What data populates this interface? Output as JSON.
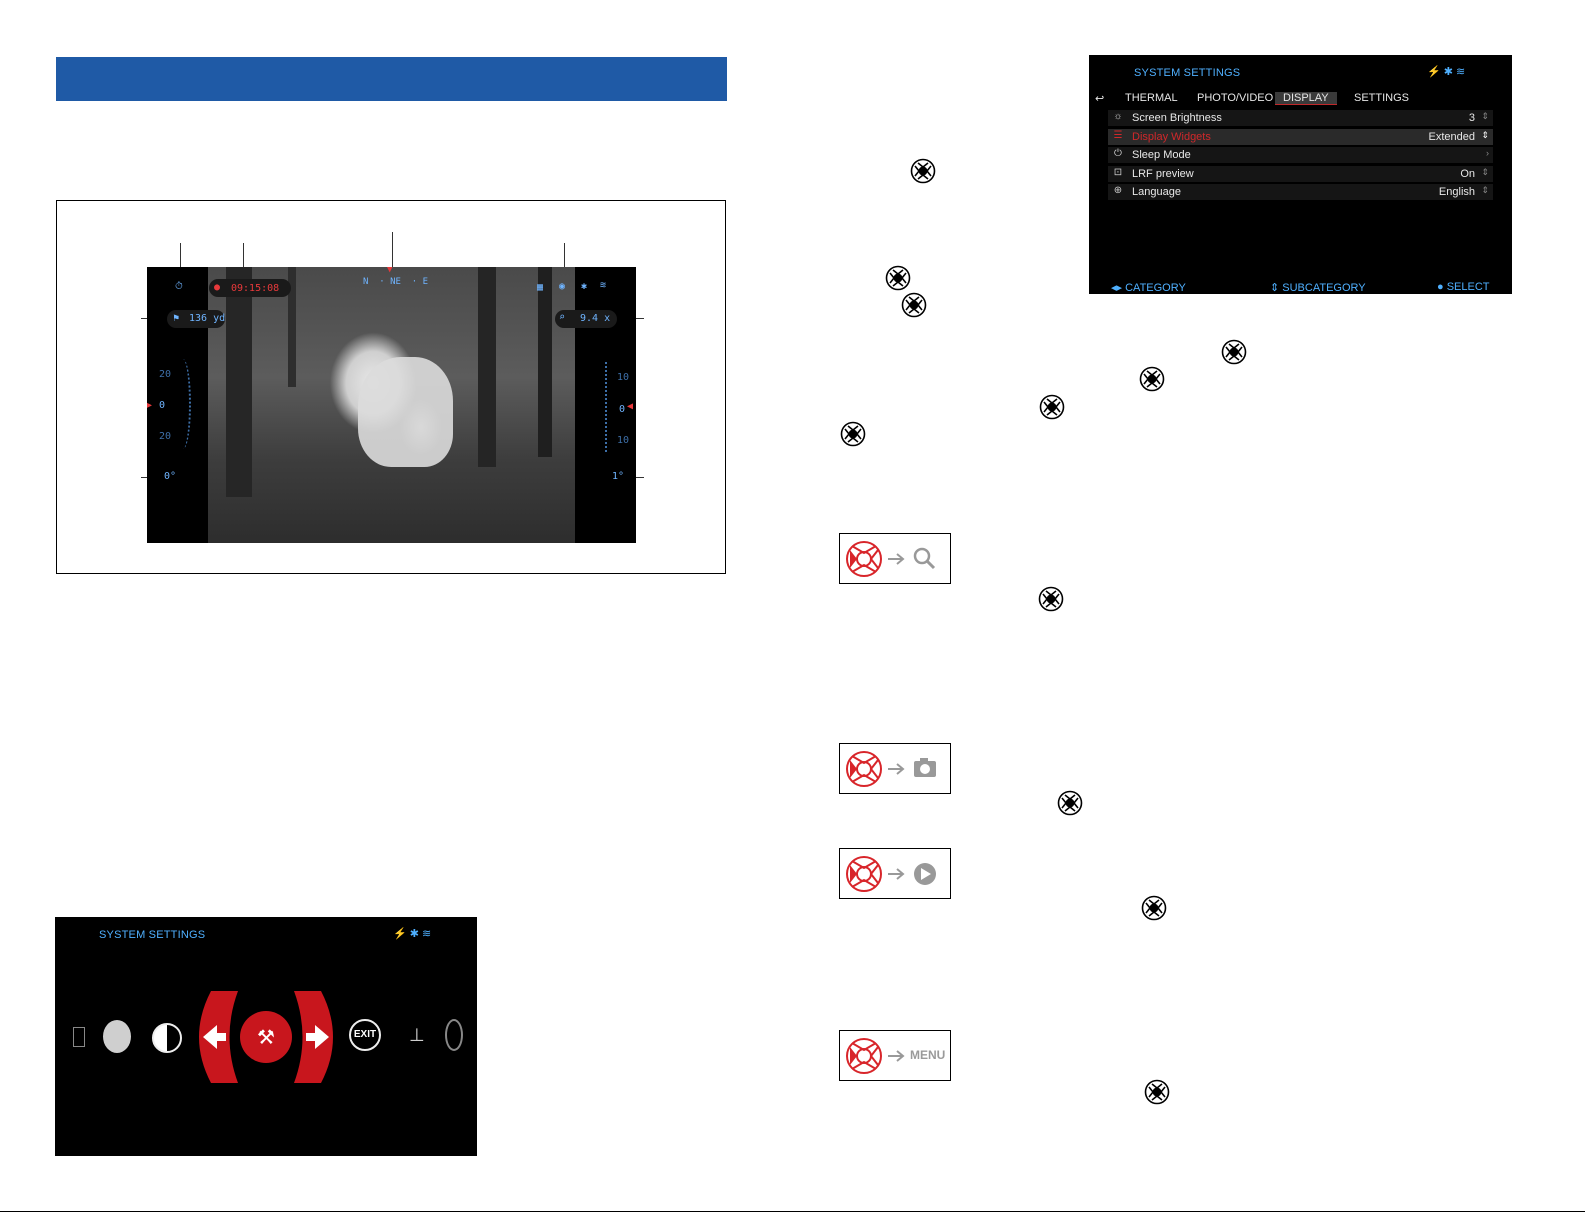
{
  "scope_display": {
    "timer_icon": "stopwatch-icon",
    "rec_time": "09:15:08",
    "compass": [
      "N",
      "NE",
      "E"
    ],
    "range": "136 yd",
    "zoom": "9.4 x",
    "left_scale": [
      "20",
      "0",
      "20"
    ],
    "left_angle": "0°",
    "right_scale": [
      "10",
      "0",
      "10"
    ],
    "right_angle": "1°"
  },
  "system_settings_top": {
    "title": "SYSTEM SETTINGS",
    "tabs": [
      "THERMAL",
      "PHOTO/VIDEO",
      "DISPLAY",
      "SETTINGS"
    ],
    "rows": [
      {
        "label": "Screen Brightness",
        "value": "3"
      },
      {
        "label": "Display Widgets",
        "value": "Extended"
      },
      {
        "label": "Sleep Mode",
        "value": ""
      },
      {
        "label": "LRF preview",
        "value": "On"
      },
      {
        "label": "Language",
        "value": "English"
      }
    ],
    "footer": {
      "category": "CATEGORY",
      "subcategory": "SUBCATEGORY",
      "select": "SELECT"
    }
  },
  "system_settings_bottom": {
    "title": "SYSTEM SETTINGS",
    "exit_label": "EXIT"
  },
  "step_boxes": {
    "menu_label": "MENU"
  },
  "colors": {
    "header_blue": "#1f5aa6",
    "hud_blue": "#6fb4ff",
    "accent_red": "#c8161d"
  }
}
